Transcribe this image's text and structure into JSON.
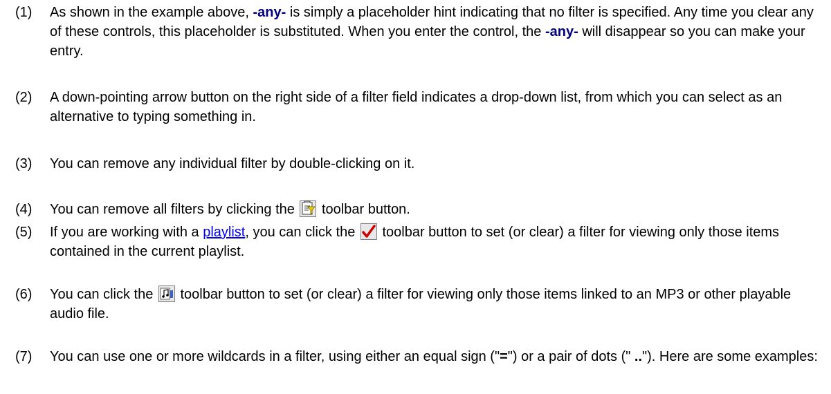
{
  "items": [
    {
      "num": "(1)",
      "t1": "As shown in the example above, ",
      "kw1": "-any-",
      "t2": " is simply a placeholder hint indicating that no filter is specified. Any time you clear any of these controls, this placeholder is substituted. When you enter the control, the ",
      "kw2": "-any-",
      "t3": " will disappear so you can make your entry."
    },
    {
      "num": "(2)",
      "text": "A down-pointing arrow button on the right side of a filter field indicates a drop-down list, from which you can select as an alternative to typing something in."
    },
    {
      "num": "(3)",
      "text": "You can remove any individual filter by double-clicking on it."
    },
    {
      "num": "(4)",
      "t1": "You can remove all filters by clicking the ",
      "icon": "clear-filters-icon",
      "t2": " toolbar button."
    },
    {
      "num": "(5)",
      "t1": "If you are working with a ",
      "link": "playlist",
      "t2": ", you can click the ",
      "icon": "checkmark-icon",
      "t3": " toolbar button to set (or clear) a filter for viewing only those items contained in the current playlist."
    },
    {
      "num": "(6)",
      "t1": "You can click the ",
      "icon": "audio-file-icon",
      "t2": " toolbar button to set (or clear) a filter for viewing only those items linked to an MP3 or other playable audio file."
    },
    {
      "num": "(7)",
      "t1": "You can use one or more wildcards in a filter, using either an equal sign (\"",
      "b1": "=",
      "t2": "\") or a pair of dots (\" ",
      "b2": "..",
      "t3": "\"). Here are some examples:"
    }
  ],
  "colors": {
    "keyword": "#000080",
    "link": "#0000ee",
    "checkmark": "#cc0000"
  }
}
